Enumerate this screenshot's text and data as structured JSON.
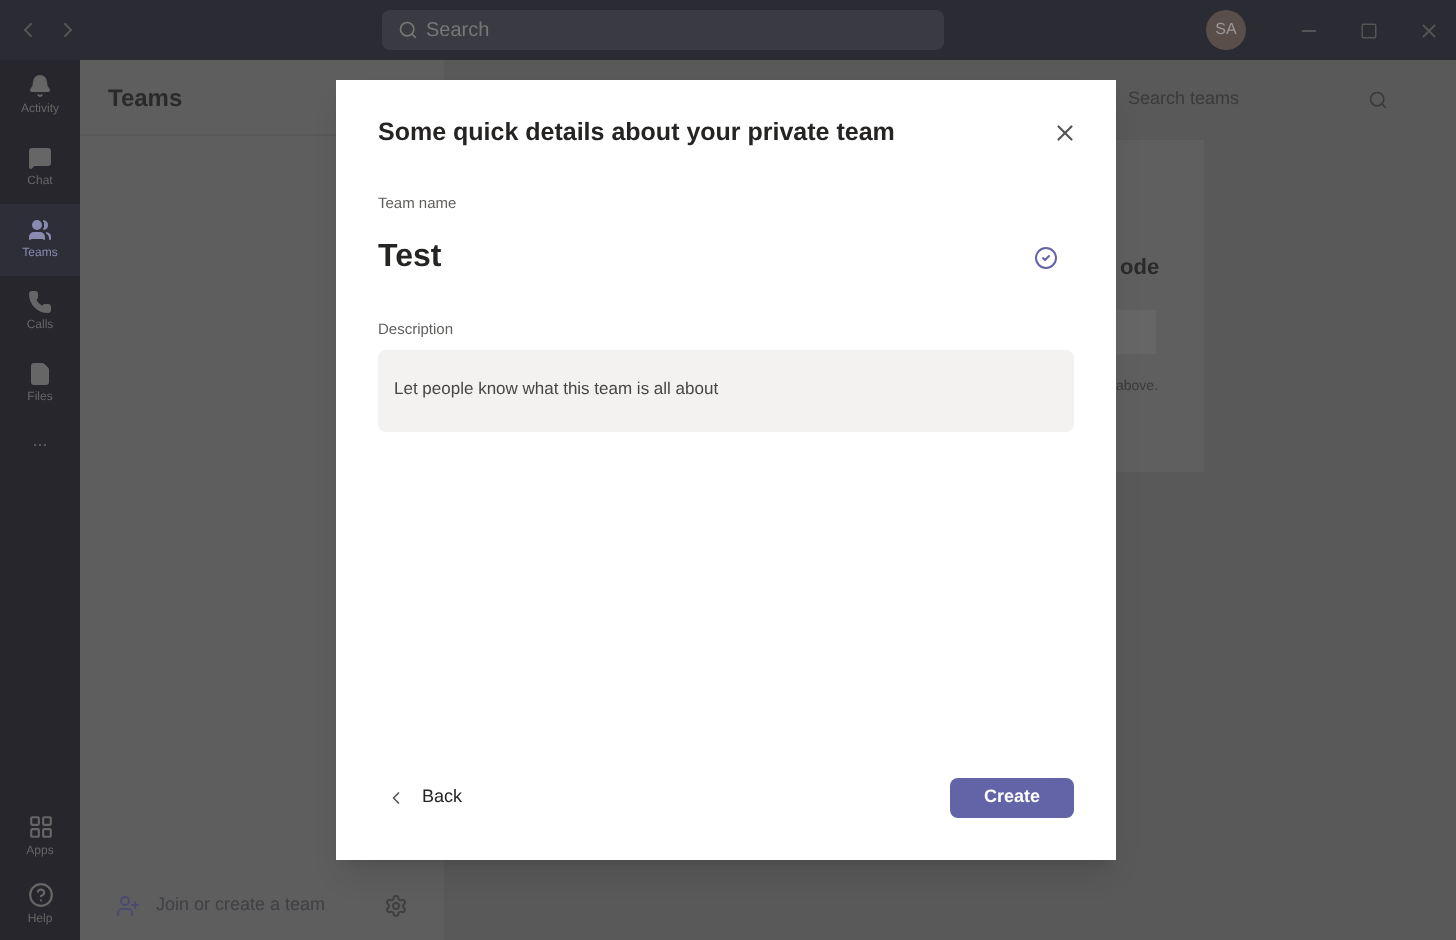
{
  "title_bar": {
    "search_placeholder": "Search",
    "avatar_initials": "SA"
  },
  "app_bar": {
    "items": [
      {
        "label": "Activity",
        "selected": false
      },
      {
        "label": "Chat",
        "selected": false
      },
      {
        "label": "Teams",
        "selected": true
      },
      {
        "label": "Calls",
        "selected": false
      },
      {
        "label": "Files",
        "selected": false
      }
    ],
    "more": "...",
    "bottom_items": [
      {
        "label": "Apps"
      },
      {
        "label": "Help"
      }
    ]
  },
  "teams_panel": {
    "title": "Teams",
    "join_label": "Join or create a team"
  },
  "main": {
    "search_placeholder": "Search teams",
    "heading_fragment": "ode",
    "hint_fragment": "above."
  },
  "dialog": {
    "title": "Some quick details about your private team",
    "name_label": "Team name",
    "name_value": "Test",
    "name_valid": true,
    "description_label": "Description",
    "description_placeholder": "Let people know what this team is all about",
    "back": "Back",
    "create": "Create"
  }
}
